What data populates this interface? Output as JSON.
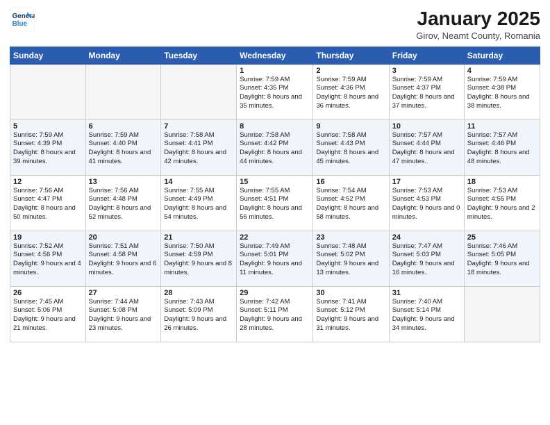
{
  "logo": {
    "line1": "General",
    "line2": "Blue"
  },
  "title": "January 2025",
  "subtitle": "Girov, Neamt County, Romania",
  "days_of_week": [
    "Sunday",
    "Monday",
    "Tuesday",
    "Wednesday",
    "Thursday",
    "Friday",
    "Saturday"
  ],
  "weeks": [
    [
      {
        "day": "",
        "info": ""
      },
      {
        "day": "",
        "info": ""
      },
      {
        "day": "",
        "info": ""
      },
      {
        "day": "1",
        "info": "Sunrise: 7:59 AM\nSunset: 4:35 PM\nDaylight: 8 hours and 35 minutes."
      },
      {
        "day": "2",
        "info": "Sunrise: 7:59 AM\nSunset: 4:36 PM\nDaylight: 8 hours and 36 minutes."
      },
      {
        "day": "3",
        "info": "Sunrise: 7:59 AM\nSunset: 4:37 PM\nDaylight: 8 hours and 37 minutes."
      },
      {
        "day": "4",
        "info": "Sunrise: 7:59 AM\nSunset: 4:38 PM\nDaylight: 8 hours and 38 minutes."
      }
    ],
    [
      {
        "day": "5",
        "info": "Sunrise: 7:59 AM\nSunset: 4:39 PM\nDaylight: 8 hours and 39 minutes."
      },
      {
        "day": "6",
        "info": "Sunrise: 7:59 AM\nSunset: 4:40 PM\nDaylight: 8 hours and 41 minutes."
      },
      {
        "day": "7",
        "info": "Sunrise: 7:58 AM\nSunset: 4:41 PM\nDaylight: 8 hours and 42 minutes."
      },
      {
        "day": "8",
        "info": "Sunrise: 7:58 AM\nSunset: 4:42 PM\nDaylight: 8 hours and 44 minutes."
      },
      {
        "day": "9",
        "info": "Sunrise: 7:58 AM\nSunset: 4:43 PM\nDaylight: 8 hours and 45 minutes."
      },
      {
        "day": "10",
        "info": "Sunrise: 7:57 AM\nSunset: 4:44 PM\nDaylight: 8 hours and 47 minutes."
      },
      {
        "day": "11",
        "info": "Sunrise: 7:57 AM\nSunset: 4:46 PM\nDaylight: 8 hours and 48 minutes."
      }
    ],
    [
      {
        "day": "12",
        "info": "Sunrise: 7:56 AM\nSunset: 4:47 PM\nDaylight: 8 hours and 50 minutes."
      },
      {
        "day": "13",
        "info": "Sunrise: 7:56 AM\nSunset: 4:48 PM\nDaylight: 8 hours and 52 minutes."
      },
      {
        "day": "14",
        "info": "Sunrise: 7:55 AM\nSunset: 4:49 PM\nDaylight: 8 hours and 54 minutes."
      },
      {
        "day": "15",
        "info": "Sunrise: 7:55 AM\nSunset: 4:51 PM\nDaylight: 8 hours and 56 minutes."
      },
      {
        "day": "16",
        "info": "Sunrise: 7:54 AM\nSunset: 4:52 PM\nDaylight: 8 hours and 58 minutes."
      },
      {
        "day": "17",
        "info": "Sunrise: 7:53 AM\nSunset: 4:53 PM\nDaylight: 9 hours and 0 minutes."
      },
      {
        "day": "18",
        "info": "Sunrise: 7:53 AM\nSunset: 4:55 PM\nDaylight: 9 hours and 2 minutes."
      }
    ],
    [
      {
        "day": "19",
        "info": "Sunrise: 7:52 AM\nSunset: 4:56 PM\nDaylight: 9 hours and 4 minutes."
      },
      {
        "day": "20",
        "info": "Sunrise: 7:51 AM\nSunset: 4:58 PM\nDaylight: 9 hours and 6 minutes."
      },
      {
        "day": "21",
        "info": "Sunrise: 7:50 AM\nSunset: 4:59 PM\nDaylight: 9 hours and 8 minutes."
      },
      {
        "day": "22",
        "info": "Sunrise: 7:49 AM\nSunset: 5:01 PM\nDaylight: 9 hours and 11 minutes."
      },
      {
        "day": "23",
        "info": "Sunrise: 7:48 AM\nSunset: 5:02 PM\nDaylight: 9 hours and 13 minutes."
      },
      {
        "day": "24",
        "info": "Sunrise: 7:47 AM\nSunset: 5:03 PM\nDaylight: 9 hours and 16 minutes."
      },
      {
        "day": "25",
        "info": "Sunrise: 7:46 AM\nSunset: 5:05 PM\nDaylight: 9 hours and 18 minutes."
      }
    ],
    [
      {
        "day": "26",
        "info": "Sunrise: 7:45 AM\nSunset: 5:06 PM\nDaylight: 9 hours and 21 minutes."
      },
      {
        "day": "27",
        "info": "Sunrise: 7:44 AM\nSunset: 5:08 PM\nDaylight: 9 hours and 23 minutes."
      },
      {
        "day": "28",
        "info": "Sunrise: 7:43 AM\nSunset: 5:09 PM\nDaylight: 9 hours and 26 minutes."
      },
      {
        "day": "29",
        "info": "Sunrise: 7:42 AM\nSunset: 5:11 PM\nDaylight: 9 hours and 28 minutes."
      },
      {
        "day": "30",
        "info": "Sunrise: 7:41 AM\nSunset: 5:12 PM\nDaylight: 9 hours and 31 minutes."
      },
      {
        "day": "31",
        "info": "Sunrise: 7:40 AM\nSunset: 5:14 PM\nDaylight: 9 hours and 34 minutes."
      },
      {
        "day": "",
        "info": ""
      }
    ]
  ]
}
